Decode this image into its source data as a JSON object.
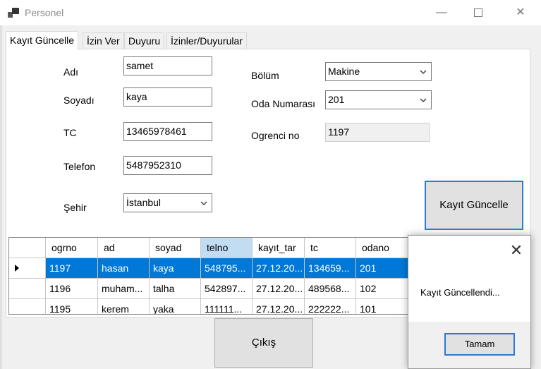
{
  "window": {
    "title": "Personel",
    "min_glyph": "—",
    "close_glyph": "✕"
  },
  "tabs": [
    {
      "label": "Kayıt Güncelle"
    },
    {
      "label": "İzin Ver"
    },
    {
      "label": "Duyuru"
    },
    {
      "label": "İzinler/Duyurular"
    }
  ],
  "form": {
    "ad_label": "Adı",
    "ad_value": "samet",
    "soyad_label": "Soyadı",
    "soyad_value": "kaya",
    "tc_label": "TC",
    "tc_value": "13465978461",
    "telefon_label": "Telefon",
    "telefon_value": "5487952310",
    "sehir_label": "Şehir",
    "sehir_value": "İstanbul",
    "bolum_label": "Bölüm",
    "bolum_value": "Makine",
    "oda_label": "Oda Numarası",
    "oda_value": "201",
    "ogrenci_label": "Ogrenci no",
    "ogrenci_value": "1197",
    "update_button": "Kayıt Güncelle"
  },
  "grid": {
    "columns": [
      "ogrno",
      "ad",
      "soyad",
      "telno",
      "kayıt_tar",
      "tc",
      "odano"
    ],
    "rows": [
      [
        "1197",
        "hasan",
        "kaya",
        "548795...",
        "27.12.20...",
        "134659...",
        "201"
      ],
      [
        "1196",
        "muham...",
        "talha",
        "542897...",
        "27.12.20...",
        "489568...",
        "102"
      ],
      [
        "1195",
        "kerem",
        "yaka",
        "111111...",
        "27.12.20...",
        "222222...",
        "101"
      ]
    ]
  },
  "exit_button": "Çıkış",
  "messagebox": {
    "text": "Kayıt Güncellendi...",
    "ok_button": "Tamam",
    "close_glyph": "✕"
  },
  "colors": {
    "accent": "#0078d7",
    "focus_border": "#2d7ad6",
    "selected_header": "#c2dcf2"
  }
}
